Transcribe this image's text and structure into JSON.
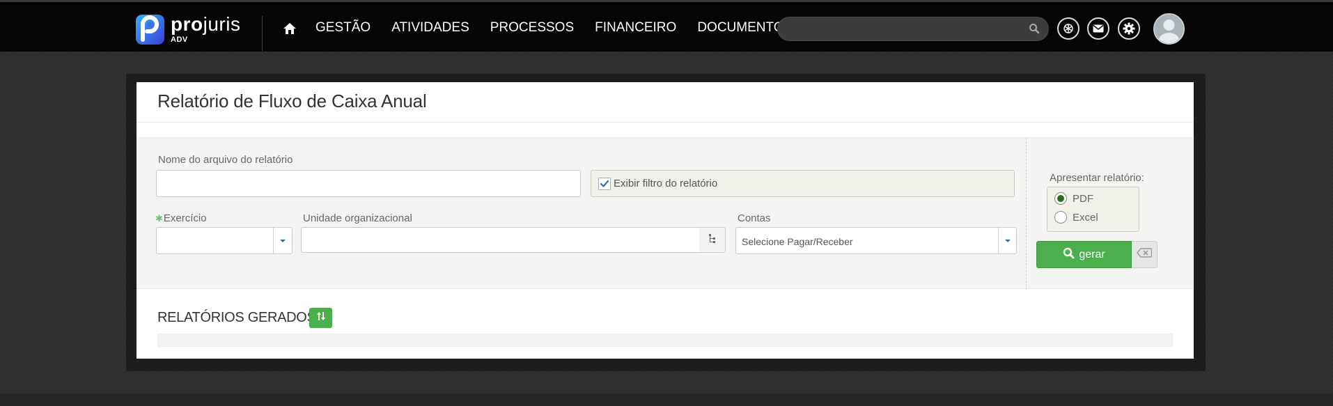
{
  "brand": {
    "word_bold": "pro",
    "word_light": "juris",
    "sub": "ADV"
  },
  "nav": {
    "home_icon": "home-icon",
    "items": [
      {
        "label": "GESTÃO"
      },
      {
        "label": "ATIVIDADES"
      },
      {
        "label": "PROCESSOS"
      },
      {
        "label": "FINANCEIRO"
      },
      {
        "label": "DOCUMENTOS"
      }
    ]
  },
  "search": {
    "placeholder": "",
    "icon": "search-icon"
  },
  "top_icons": [
    "openai-icon",
    "mail-icon",
    "settings-gear-icon"
  ],
  "page": {
    "title": "Relatório de Fluxo de Caixa Anual"
  },
  "form": {
    "filename_label": "Nome do arquivo do relatório",
    "filename_value": "",
    "show_filter_label": "Exibir filtro do relatório",
    "show_filter_checked": true,
    "exercicio_label": "Exercício",
    "exercicio_value": "",
    "unidade_label": "Unidade organizacional",
    "unidade_value": "",
    "contas_label": "Contas",
    "contas_value": "Selecione Pagar/Receber",
    "present_label": "Apresentar relatório:",
    "formats": [
      {
        "label": "PDF",
        "selected": true
      },
      {
        "label": "Excel",
        "selected": false
      }
    ],
    "generate_label": "gerar"
  },
  "generated": {
    "title": "RELATÓRIOS GERADOS"
  },
  "colors": {
    "accent_green": "#4cae4c",
    "topbar": "#050505",
    "background": "#2e2e2e"
  }
}
